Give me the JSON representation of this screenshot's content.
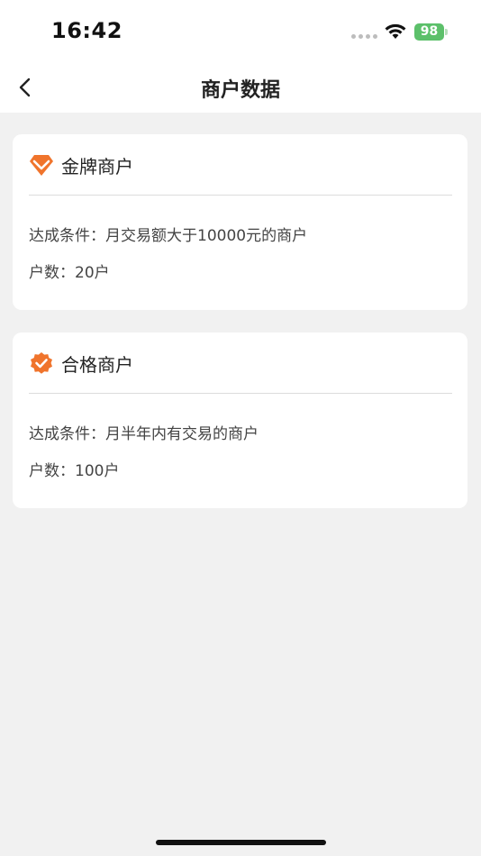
{
  "status_bar": {
    "time": "16:42",
    "battery": "98"
  },
  "nav": {
    "title": "商户数据",
    "back_icon": "chevron-left-icon"
  },
  "cards": [
    {
      "icon": "gold-diamond-badge-icon",
      "title": "金牌商户",
      "condition_label": "达成条件：",
      "condition": "月交易额大于10000元的商户",
      "count_label": "户数：",
      "count": "20户"
    },
    {
      "icon": "qualified-check-badge-icon",
      "title": "合格商户",
      "condition_label": "达成条件：",
      "condition": "月半年内有交易的商户",
      "count_label": "户数：",
      "count": "100户"
    }
  ],
  "colors": {
    "accent_orange": "#f0742c",
    "page_bg": "#f1f1f1",
    "battery_green": "#5cc06a"
  }
}
